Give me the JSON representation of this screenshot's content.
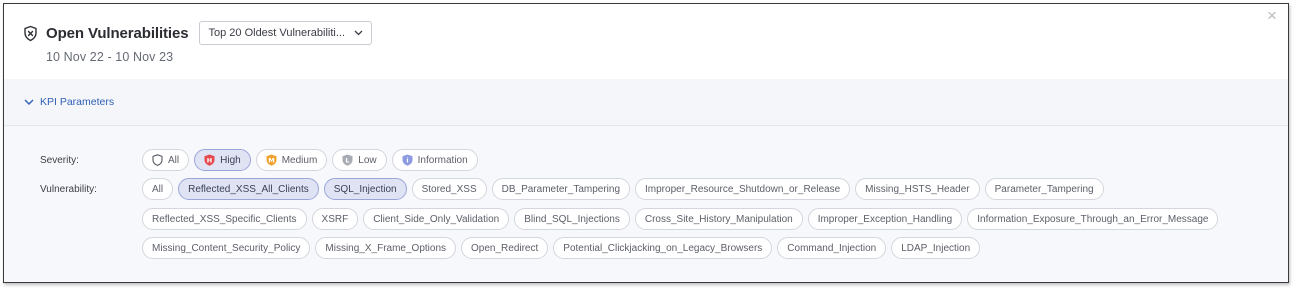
{
  "header": {
    "title": "Open Vulnerabilities",
    "report_select": "Top 20 Oldest Vulnerabiliti...",
    "date_range": "10 Nov 22 - 10 Nov 23",
    "close_glyph": "×"
  },
  "kpi": {
    "label": "KPI Parameters"
  },
  "severity": {
    "label": "Severity:",
    "options": [
      {
        "label": "All",
        "icon": "shield-outline-icon",
        "selected": false
      },
      {
        "label": "High",
        "icon": "shield-high-icon",
        "selected": true,
        "color": "#e5484d"
      },
      {
        "label": "Medium",
        "icon": "shield-medium-icon",
        "selected": false,
        "color": "#f0a330"
      },
      {
        "label": "Low",
        "icon": "shield-low-icon",
        "selected": false,
        "color": "#a7abb3"
      },
      {
        "label": "Information",
        "icon": "shield-info-icon",
        "selected": false,
        "color": "#8d9be0"
      }
    ]
  },
  "vulnerability": {
    "label": "Vulnerability:",
    "rows": [
      [
        "All",
        "Reflected_XSS_All_Clients",
        "SQL_Injection",
        "Stored_XSS",
        "DB_Parameter_Tampering",
        "Improper_Resource_Shutdown_or_Release",
        "Missing_HSTS_Header",
        "Parameter_Tampering"
      ],
      [
        "Reflected_XSS_Specific_Clients",
        "XSRF",
        "Client_Side_Only_Validation",
        "Blind_SQL_Injections",
        "Cross_Site_History_Manipulation",
        "Improper_Exception_Handling",
        "Information_Exposure_Through_an_Error_Message"
      ],
      [
        "Missing_Content_Security_Policy",
        "Missing_X_Frame_Options",
        "Open_Redirect",
        "Potential_Clickjacking_on_Legacy_Browsers",
        "Command_Injection",
        "LDAP_Injection"
      ]
    ],
    "selected": [
      "Reflected_XSS_All_Clients",
      "SQL_Injection"
    ]
  },
  "colors": {
    "accent": "#2f5fb3",
    "selected_chip_bg": "#dfe3f4",
    "panel_bg": "#f7f8fb"
  }
}
